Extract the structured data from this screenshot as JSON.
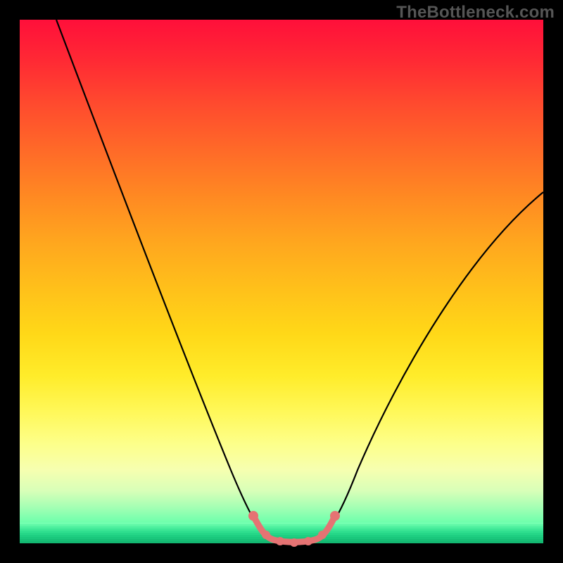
{
  "watermark": "TheBottleneck.com",
  "chart_data": {
    "type": "line",
    "title": "",
    "xlabel": "",
    "ylabel": "",
    "xlim": [
      0,
      100
    ],
    "ylim": [
      0,
      100
    ],
    "series": [
      {
        "name": "bottleneck-curve",
        "x": [
          7,
          12,
          18,
          24,
          30,
          36,
          40,
          44,
          46,
          48,
          50,
          52,
          54,
          56,
          58,
          62,
          68,
          74,
          80,
          86,
          92,
          98,
          100
        ],
        "y": [
          100,
          88,
          74,
          60,
          46,
          32,
          22,
          12,
          6,
          2,
          0.5,
          0,
          0,
          0.5,
          2,
          8,
          18,
          28,
          38,
          47,
          56,
          64,
          67
        ]
      }
    ],
    "highlight_segment": {
      "name": "valley-highlight",
      "color": "#e57373",
      "x": [
        46,
        48,
        50,
        52,
        54,
        56,
        58
      ],
      "y": [
        6,
        2,
        0.5,
        0,
        0,
        0.5,
        2
      ]
    },
    "highlight_points": {
      "name": "valley-markers",
      "color": "#e57373",
      "points": [
        {
          "x": 46,
          "y": 6
        },
        {
          "x": 48,
          "y": 2
        },
        {
          "x": 50,
          "y": 0.5
        },
        {
          "x": 52,
          "y": 0
        },
        {
          "x": 54,
          "y": 0
        },
        {
          "x": 56,
          "y": 0.5
        },
        {
          "x": 58,
          "y": 2
        }
      ]
    },
    "gradient_colors": {
      "top": "#ff0f3a",
      "mid": "#ffd818",
      "bottom": "#30f59a"
    }
  }
}
